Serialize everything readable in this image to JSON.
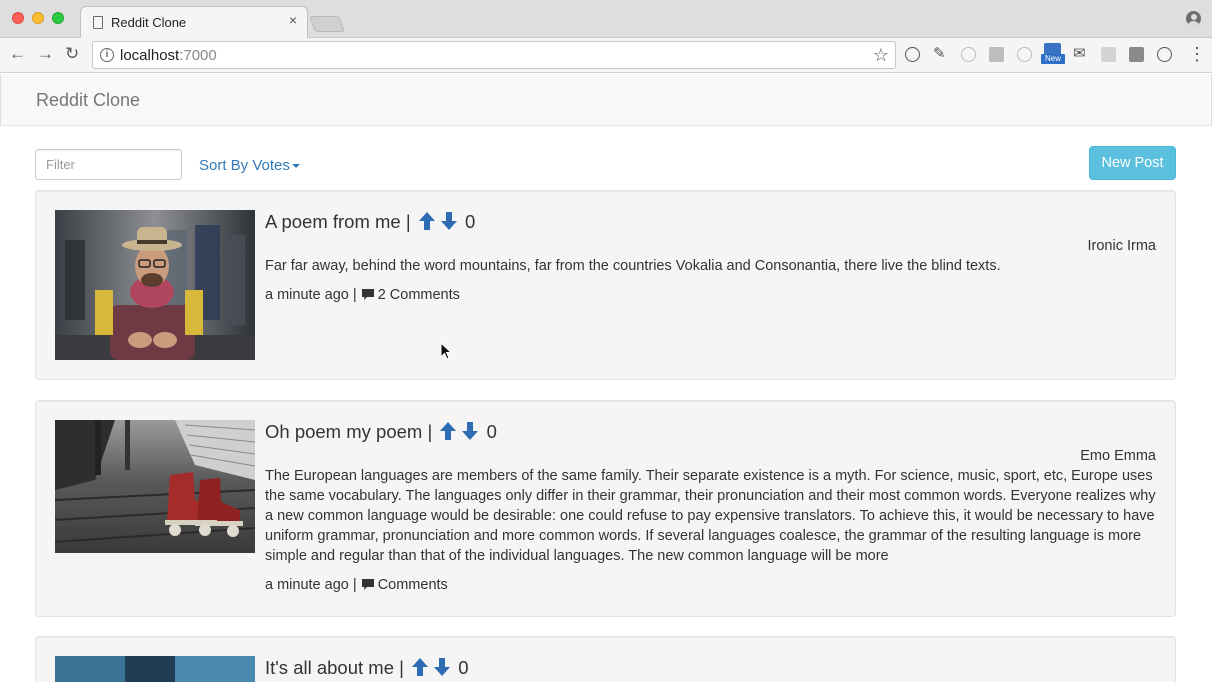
{
  "browser": {
    "tab_title": "Reddit Clone",
    "tab_close": "×",
    "url_host": "localhost",
    "url_port": ":7000",
    "new_badge": "New",
    "accent": "#2d6ec9"
  },
  "navbar": {
    "brand": "Reddit Clone"
  },
  "controls": {
    "filter_placeholder": "Filter",
    "sort_label": "Sort By Votes",
    "new_post_label": "New Post",
    "new_post_color": "#5bc0de",
    "link_color": "#337ab7"
  },
  "posts": [
    {
      "title": "A poem from me",
      "separator": "|",
      "score": "0",
      "author": "Ironic Irma",
      "body": "Far far away, behind the word mountains, far from the countries Vokalia and Consonantia, there live the blind texts.",
      "time": "a minute ago",
      "meta_sep": "|",
      "comments": "2 Comments",
      "image": "man-with-hat-photo"
    },
    {
      "title": "Oh poem my poem",
      "separator": "|",
      "score": "0",
      "author": "Emo Emma",
      "body": "The European languages are members of the same family. Their separate existence is a myth. For science, music, sport, etc, Europe uses the same vocabulary. The languages only differ in their grammar, their pronunciation and their most common words. Everyone realizes why a new common language would be desirable: one could refuse to pay expensive translators. To achieve this, it would be necessary to have uniform grammar, pronunciation and more common words. If several languages coalesce, the grammar of the resulting language is more simple and regular than that of the individual languages. The new common language will be more",
      "time": "a minute ago",
      "meta_sep": "|",
      "comments": "Comments",
      "image": "roller-skates-photo"
    },
    {
      "title": "It's all about me",
      "separator": "|",
      "score": "0",
      "image": "denim-photo"
    }
  ]
}
